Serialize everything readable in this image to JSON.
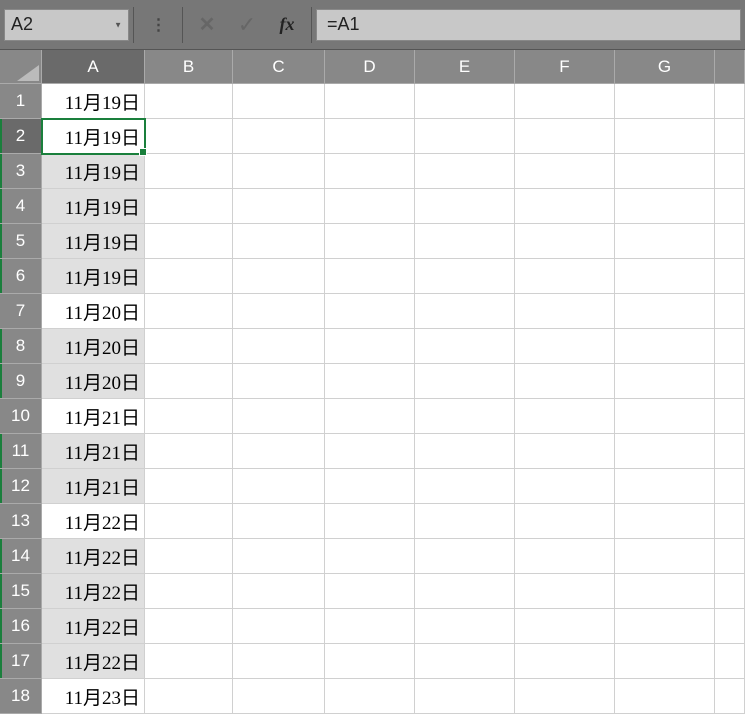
{
  "namebox": {
    "value": "A2"
  },
  "formula": {
    "value": "=A1"
  },
  "columns": [
    "A",
    "B",
    "C",
    "D",
    "E",
    "F",
    "G",
    ""
  ],
  "activeCell": {
    "row": 2,
    "col": "A"
  },
  "rows": [
    {
      "n": 1,
      "A": "11月19日",
      "duplicate": false
    },
    {
      "n": 2,
      "A": "11月19日",
      "duplicate": false
    },
    {
      "n": 3,
      "A": "11月19日",
      "duplicate": true
    },
    {
      "n": 4,
      "A": "11月19日",
      "duplicate": true
    },
    {
      "n": 5,
      "A": "11月19日",
      "duplicate": true
    },
    {
      "n": 6,
      "A": "11月19日",
      "duplicate": true
    },
    {
      "n": 7,
      "A": "11月20日",
      "duplicate": false
    },
    {
      "n": 8,
      "A": "11月20日",
      "duplicate": true
    },
    {
      "n": 9,
      "A": "11月20日",
      "duplicate": true
    },
    {
      "n": 10,
      "A": "11月21日",
      "duplicate": false
    },
    {
      "n": 11,
      "A": "11月21日",
      "duplicate": true
    },
    {
      "n": 12,
      "A": "11月21日",
      "duplicate": true
    },
    {
      "n": 13,
      "A": "11月22日",
      "duplicate": false
    },
    {
      "n": 14,
      "A": "11月22日",
      "duplicate": true
    },
    {
      "n": 15,
      "A": "11月22日",
      "duplicate": true
    },
    {
      "n": 16,
      "A": "11月22日",
      "duplicate": true
    },
    {
      "n": 17,
      "A": "11月22日",
      "duplicate": true
    },
    {
      "n": 18,
      "A": "11月23日",
      "duplicate": false
    }
  ]
}
